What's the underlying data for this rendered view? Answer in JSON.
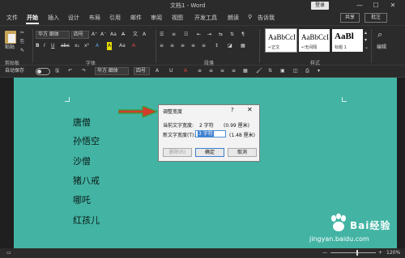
{
  "window": {
    "title": "文档1 - Word",
    "login_label": "登录",
    "min_glyph": "—",
    "max_glyph": "☐",
    "close_glyph": "✕"
  },
  "tabs": [
    {
      "label": "文件"
    },
    {
      "label": "开始"
    },
    {
      "label": "插入"
    },
    {
      "label": "设计"
    },
    {
      "label": "布局"
    },
    {
      "label": "引用"
    },
    {
      "label": "邮件"
    },
    {
      "label": "审阅"
    },
    {
      "label": "视图"
    },
    {
      "label": "开发工具"
    },
    {
      "label": "朗读"
    },
    {
      "label": "告诉我"
    }
  ],
  "active_tab": "开始",
  "share_label": "共享",
  "comment_label": "批注",
  "ribbon": {
    "clipboard": {
      "paste_label": "粘贴",
      "group_label": "剪贴板"
    },
    "font": {
      "font_name": "华方 细体",
      "font_size": "四号",
      "group_label": "字体",
      "buttons": [
        "B",
        "I",
        "U",
        "abc",
        "x₂",
        "x²",
        "A",
        "A",
        "Aa",
        "A"
      ]
    },
    "paragraph": {
      "group_label": "段落"
    },
    "styles": {
      "group_label": "样式",
      "items": [
        {
          "sample": "AaBbCcI",
          "name": "↵正文"
        },
        {
          "sample": "AaBbCcI",
          "name": "↵无间隔"
        },
        {
          "sample": "AaBl",
          "name": "标题 1"
        }
      ]
    },
    "editing": {
      "label": "编辑"
    }
  },
  "qat": {
    "autosave_label": "自动保存",
    "font_name": "华方 细体",
    "font_size": "四号"
  },
  "document": {
    "lines": [
      "唐僧",
      "孙悟空",
      "沙僧",
      "猪八戒",
      "哪吒",
      "红孩儿"
    ]
  },
  "dialog": {
    "title": "调整宽度",
    "help": "?",
    "close": "✕",
    "current_label": "当前文字宽度:",
    "current_value": "2 字符",
    "current_cm": "(0.99 厘米)",
    "new_label": "新文字宽度(T):",
    "new_value": "3 字符",
    "new_cm": "(1.48 厘米)",
    "delete_label": "删除(R)",
    "ok_label": "确定",
    "cancel_label": "取消"
  },
  "status": {
    "zoom_minus": "—",
    "zoom_plus": "+",
    "zoom": "120%"
  },
  "watermark": {
    "brand": "Bai",
    "brand_cn": "经验",
    "url": "jingyan.baidu.com"
  },
  "colors": {
    "page_bg": "#43b4a4",
    "ribbon_bg": "#2b2b2b",
    "arrow_red": "#d43c2c",
    "arrow_green": "#3c9a3c"
  }
}
